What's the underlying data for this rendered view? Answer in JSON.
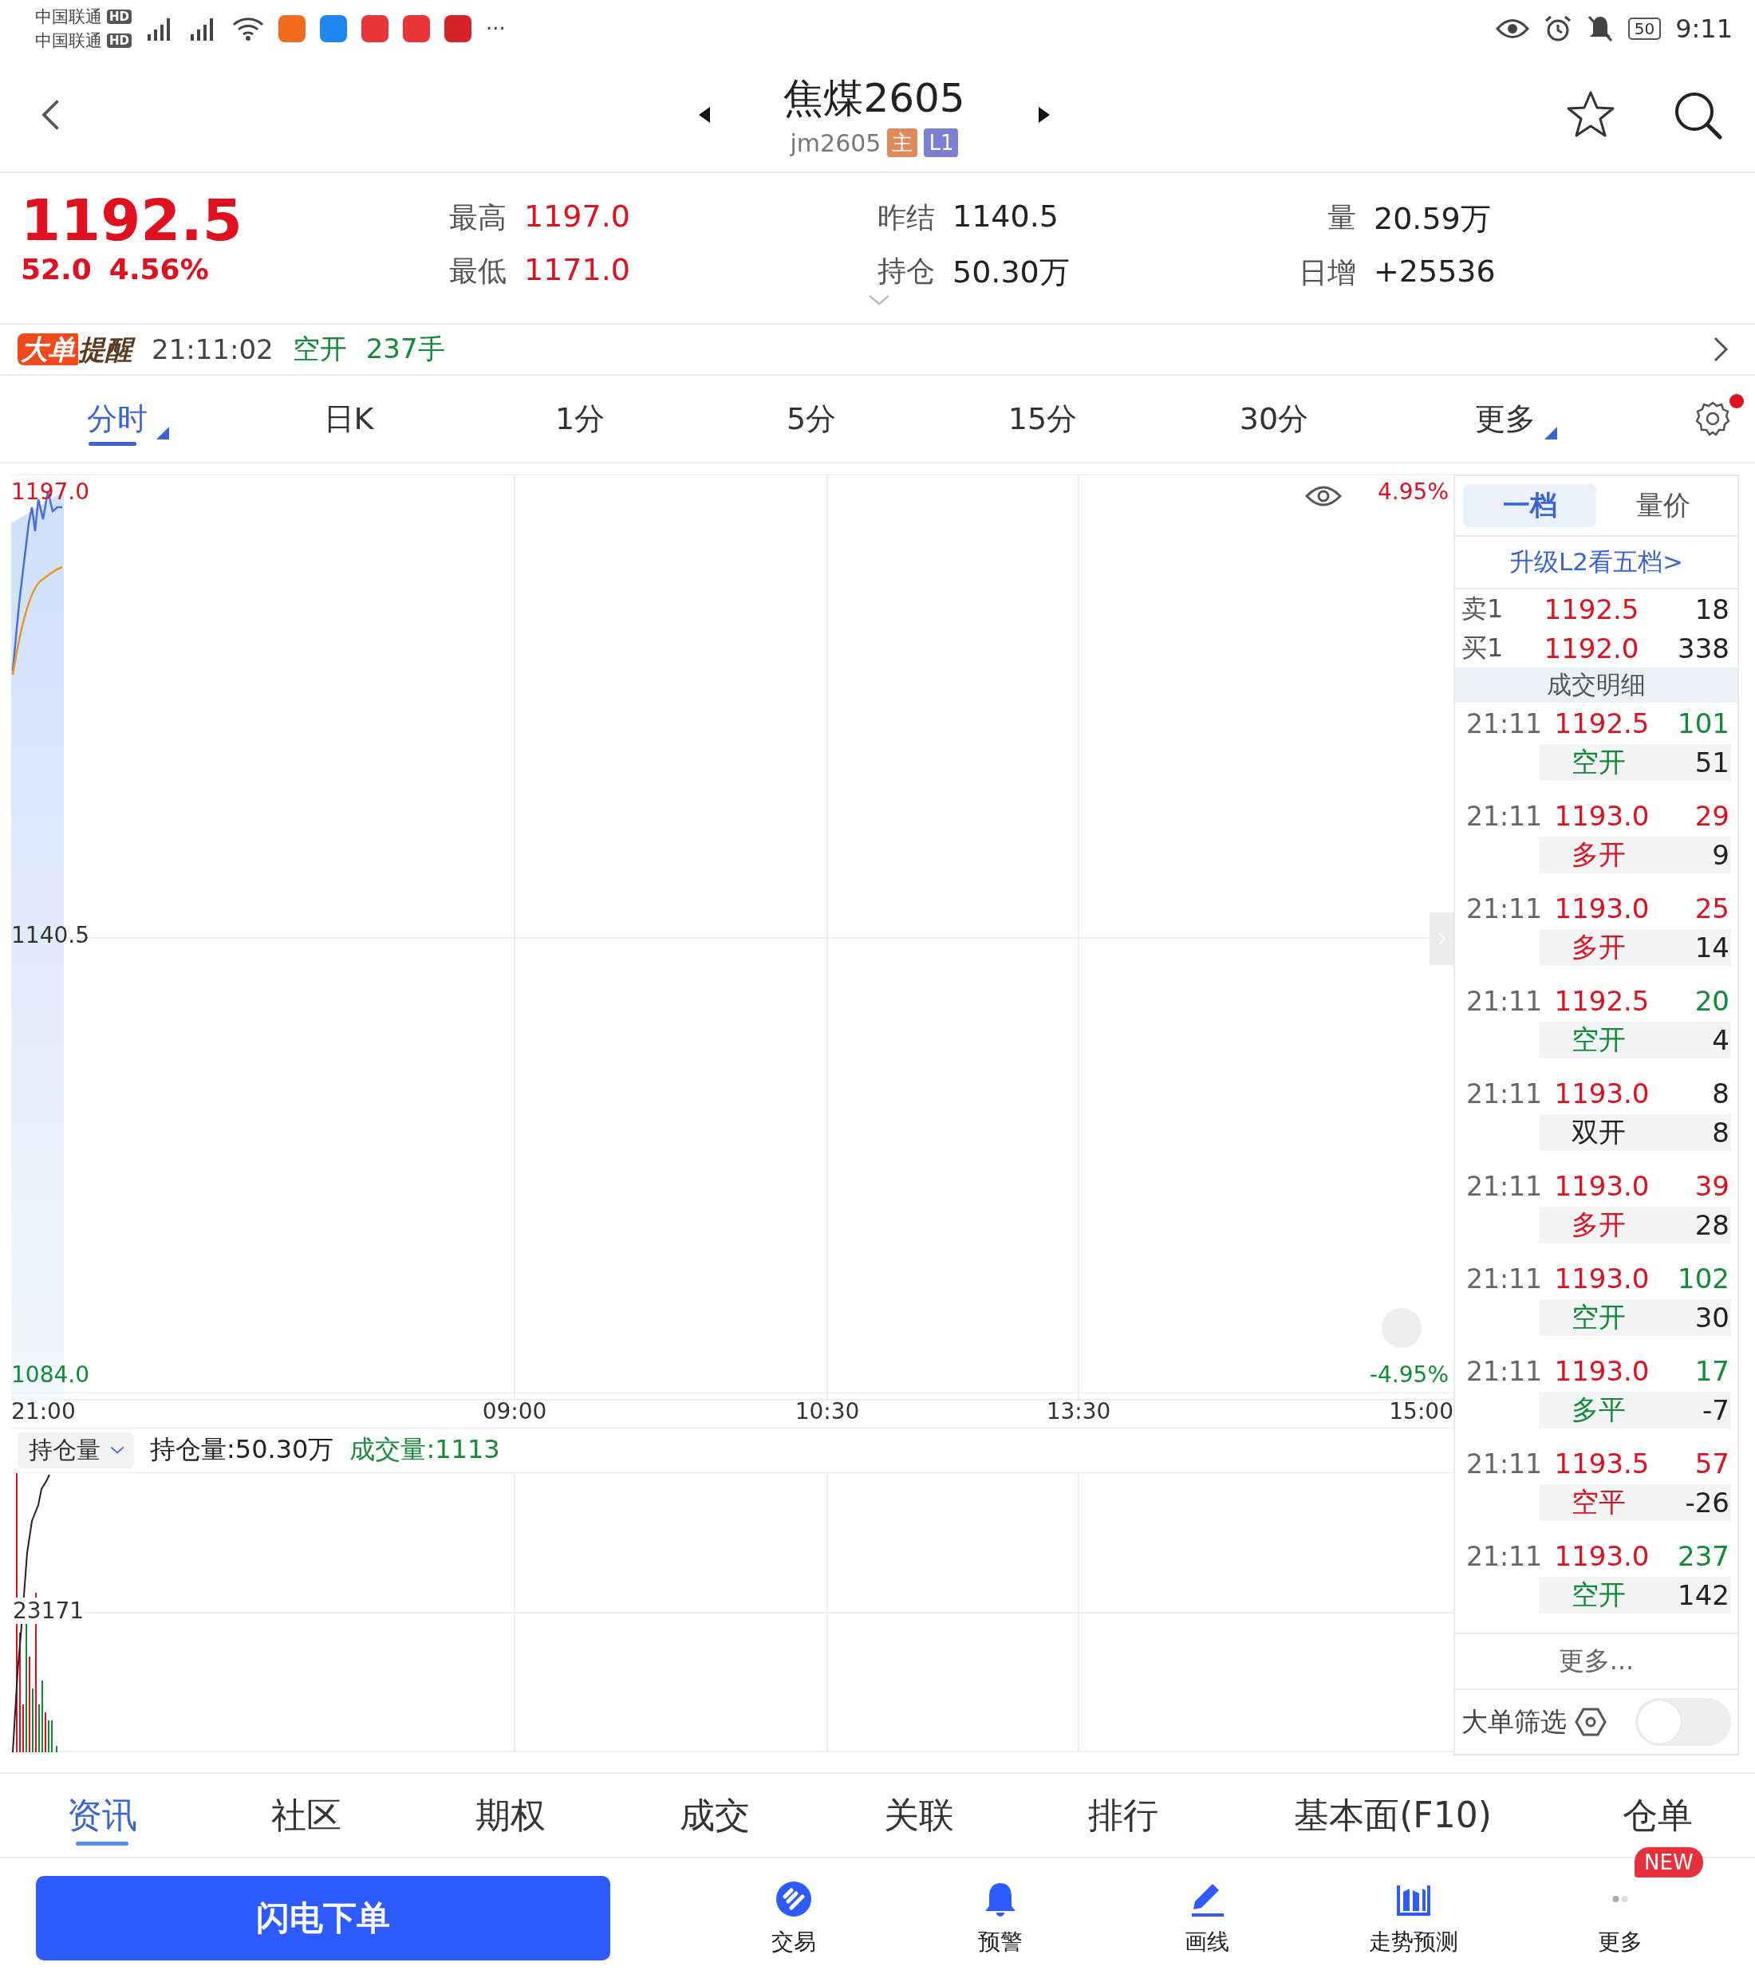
{
  "status_bar": {
    "carriers": [
      {
        "name": "中国联通",
        "badge": "HD"
      },
      {
        "name": "中国联通",
        "badge": "HD"
      }
    ],
    "apps": [
      {
        "color": "#f26b1d"
      },
      {
        "color": "#1e88f0"
      },
      {
        "color": "#e8353a"
      },
      {
        "color": "#e8353a"
      },
      {
        "color": "#d8222a"
      }
    ],
    "more": "···",
    "battery": "50",
    "time": "9:11"
  },
  "header": {
    "title": "焦煤2605",
    "code": "jm2605",
    "badges": [
      {
        "label": "主",
        "color": "#e2895b"
      },
      {
        "label": "L1",
        "color": "#7c80d2"
      }
    ],
    "favorite": false
  },
  "quote": {
    "price": "1192.5",
    "change": "52.0",
    "change_pct": "4.56%",
    "columns": [
      [
        {
          "label": "最高",
          "value": "1197.0",
          "color": "#e0101e"
        },
        {
          "label": "最低",
          "value": "1171.0",
          "color": "#e0101e"
        }
      ],
      [
        {
          "label": "昨结",
          "value": "1140.5",
          "color": "#222222"
        },
        {
          "label": "持仓",
          "value": "50.30万",
          "color": "#222222"
        }
      ],
      [
        {
          "label": "量",
          "value": "20.59万",
          "color": "#222222"
        },
        {
          "label": "日增",
          "value": "+25536",
          "color": "#222222"
        }
      ]
    ]
  },
  "alert": {
    "badge_main": "大单",
    "badge_sub": "提醒",
    "time": "21:11:02",
    "action": "空开",
    "volume": "237手"
  },
  "period_tabs": [
    {
      "label": "分时",
      "selected": true,
      "menu": true
    },
    {
      "label": "日K",
      "selected": false,
      "menu": false
    },
    {
      "label": "1分",
      "selected": false,
      "menu": false
    },
    {
      "label": "5分",
      "selected": false,
      "menu": false
    },
    {
      "label": "15分",
      "selected": false,
      "menu": false
    },
    {
      "label": "30分",
      "selected": false,
      "menu": false
    },
    {
      "label": "更多",
      "selected": false,
      "menu": true
    }
  ],
  "settings_badge": true,
  "chart": {
    "high": "1197.0",
    "mid": "1140.5",
    "low": "1084.0",
    "up_pct": "4.95%",
    "down_pct": "-4.95%",
    "times": [
      "21:00",
      "09:00",
      "10:30",
      "13:30",
      "15:00"
    ]
  },
  "sub_chart": {
    "selector": "持仓量",
    "open_interest": "持仓量:50.30万",
    "volume": "成交量:1113",
    "mark": "23171"
  },
  "side_panel": {
    "tabs": [
      {
        "label": "一档",
        "selected": true
      },
      {
        "label": "量价",
        "selected": false
      }
    ],
    "upgrade_link": "升级L2看五档>",
    "book": [
      {
        "side": "卖1",
        "price": "1192.5",
        "qty": "18"
      },
      {
        "side": "买1",
        "price": "1192.0",
        "qty": "338"
      }
    ],
    "trades_title": "成交明细",
    "trades": [
      {
        "time": "21:11",
        "price": "1192.5",
        "volume": {
          "text": "101",
          "color": "#138a36"
        },
        "action": {
          "text": "空开",
          "color": "#138a36"
        },
        "change": "51"
      },
      {
        "time": "21:11",
        "price": "1193.0",
        "volume": {
          "text": "29",
          "color": "#e0101e"
        },
        "action": {
          "text": "多开",
          "color": "#e0101e"
        },
        "change": "9"
      },
      {
        "time": "21:11",
        "price": "1193.0",
        "volume": {
          "text": "25",
          "color": "#e0101e"
        },
        "action": {
          "text": "多开",
          "color": "#e0101e"
        },
        "change": "14"
      },
      {
        "time": "21:11",
        "price": "1192.5",
        "volume": {
          "text": "20",
          "color": "#138a36"
        },
        "action": {
          "text": "空开",
          "color": "#138a36"
        },
        "change": "4"
      },
      {
        "time": "21:11",
        "price": "1193.0",
        "volume": {
          "text": "8",
          "color": "#222222"
        },
        "action": {
          "text": "双开",
          "color": "#222222"
        },
        "change": "8"
      },
      {
        "time": "21:11",
        "price": "1193.0",
        "volume": {
          "text": "39",
          "color": "#e0101e"
        },
        "action": {
          "text": "多开",
          "color": "#e0101e"
        },
        "change": "28"
      },
      {
        "time": "21:11",
        "price": "1193.0",
        "volume": {
          "text": "102",
          "color": "#138a36"
        },
        "action": {
          "text": "空开",
          "color": "#138a36"
        },
        "change": "30"
      },
      {
        "time": "21:11",
        "price": "1193.0",
        "volume": {
          "text": "17",
          "color": "#138a36"
        },
        "action": {
          "text": "多平",
          "color": "#138a36"
        },
        "change": "-7"
      },
      {
        "time": "21:11",
        "price": "1193.5",
        "volume": {
          "text": "57",
          "color": "#e0101e"
        },
        "action": {
          "text": "空平",
          "color": "#e0101e"
        },
        "change": "-26"
      },
      {
        "time": "21:11",
        "price": "1193.0",
        "volume": {
          "text": "237",
          "color": "#138a36"
        },
        "action": {
          "text": "空开",
          "color": "#138a36"
        },
        "change": "142"
      }
    ],
    "more": "更多...",
    "filter": {
      "label": "大单筛选",
      "on": false
    }
  },
  "bottom_tabs": [
    {
      "label": "资讯",
      "selected": true
    },
    {
      "label": "社区",
      "selected": false
    },
    {
      "label": "期权",
      "selected": false
    },
    {
      "label": "成交",
      "selected": false
    },
    {
      "label": "关联",
      "selected": false
    },
    {
      "label": "排行",
      "selected": false
    },
    {
      "label": "基本面(F10)",
      "selected": false
    },
    {
      "label": "仓单",
      "selected": false
    }
  ],
  "actions": {
    "primary": "闪电下单",
    "items": [
      {
        "label": "交易",
        "kind": "trade"
      },
      {
        "label": "预警",
        "kind": "alert"
      },
      {
        "label": "画线",
        "kind": "draw"
      },
      {
        "label": "走势预测",
        "kind": "forecast"
      },
      {
        "label": "更多",
        "kind": "more",
        "badge": "NEW"
      }
    ]
  }
}
